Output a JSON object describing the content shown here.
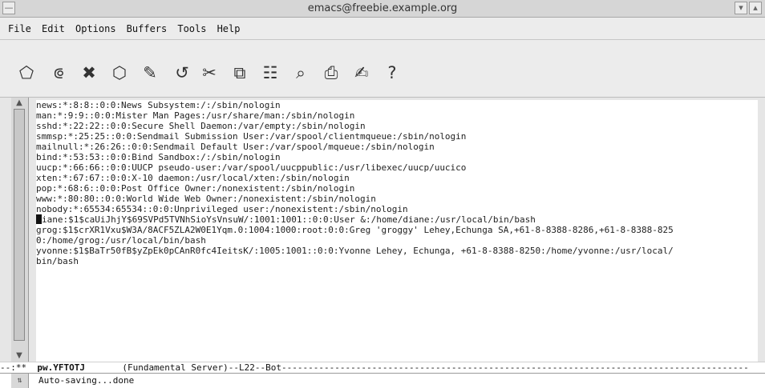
{
  "window": {
    "title": "emacs@freebie.example.org"
  },
  "menu": {
    "items": [
      "File",
      "Edit",
      "Options",
      "Buffers",
      "Tools",
      "Help"
    ]
  },
  "toolbar": {
    "icons": [
      {
        "name": "new-file-icon",
        "glyph": "⬠"
      },
      {
        "name": "open-folder-icon",
        "glyph": "⟃"
      },
      {
        "name": "close-buffer-icon",
        "glyph": "✖"
      },
      {
        "name": "save-icon",
        "glyph": "⬡"
      },
      {
        "name": "save-as-icon",
        "glyph": "✎"
      },
      {
        "name": "undo-icon",
        "glyph": "↺"
      },
      {
        "name": "cut-icon",
        "glyph": "✂"
      },
      {
        "name": "copy-icon",
        "glyph": "⧉"
      },
      {
        "name": "paste-icon",
        "glyph": "☷"
      },
      {
        "name": "search-icon",
        "glyph": "⌕"
      },
      {
        "name": "print-icon",
        "glyph": "⎙"
      },
      {
        "name": "customize-icon",
        "glyph": "✍"
      },
      {
        "name": "help-icon",
        "glyph": "?"
      }
    ]
  },
  "editor": {
    "lines": [
      "news:*:8:8::0:0:News Subsystem:/:/sbin/nologin",
      "man:*:9:9::0:0:Mister Man Pages:/usr/share/man:/sbin/nologin",
      "sshd:*:22:22::0:0:Secure Shell Daemon:/var/empty:/sbin/nologin",
      "smmsp:*:25:25::0:0:Sendmail Submission User:/var/spool/clientmqueue:/sbin/nologin",
      "mailnull:*:26:26::0:0:Sendmail Default User:/var/spool/mqueue:/sbin/nologin",
      "bind:*:53:53::0:0:Bind Sandbox:/:/sbin/nologin",
      "uucp:*:66:66::0:0:UUCP pseudo-user:/var/spool/uucppublic:/usr/libexec/uucp/uucico",
      "xten:*:67:67::0:0:X-10 daemon:/usr/local/xten:/sbin/nologin",
      "pop:*:68:6::0:0:Post Office Owner:/nonexistent:/sbin/nologin",
      "www:*:80:80::0:0:World Wide Web Owner:/nonexistent:/sbin/nologin",
      "nobody:*:65534:65534::0:0:Unprivileged user:/nonexistent:/sbin/nologin",
      "iane:$1$caUiJhjY$69SVPd5TVNhSioYsVnsuW/:1001:1001::0:0:User &:/home/diane:/usr/local/bin/bash",
      "grog:$1$crXR1Vxu$W3A/8ACF5ZLA2W0E1Yqm.0:1004:1000:root:0:0:Greg 'groggy' Lehey,Echunga SA,+61-8-8388-8286,+61-8-8388-825",
      "0:/home/grog:/usr/local/bin/bash",
      "yvonne:$1$BaTr50fB$yZpEk0pCAnR0fc4IeitsK/:1005:1001::0:0:Yvonne Lehey, Echunga, +61-8-8388-8250:/home/yvonne:/usr/local/",
      "bin/bash"
    ],
    "cursor_char": "d"
  },
  "modeline": {
    "prefix": "--:**  ",
    "buffer": "pw.YFTOTJ",
    "rest": "       (Fundamental Server)--L22--Bot----------------------------------------------------------------------------------------"
  },
  "minibuffer": {
    "message": "Auto-saving...done"
  }
}
